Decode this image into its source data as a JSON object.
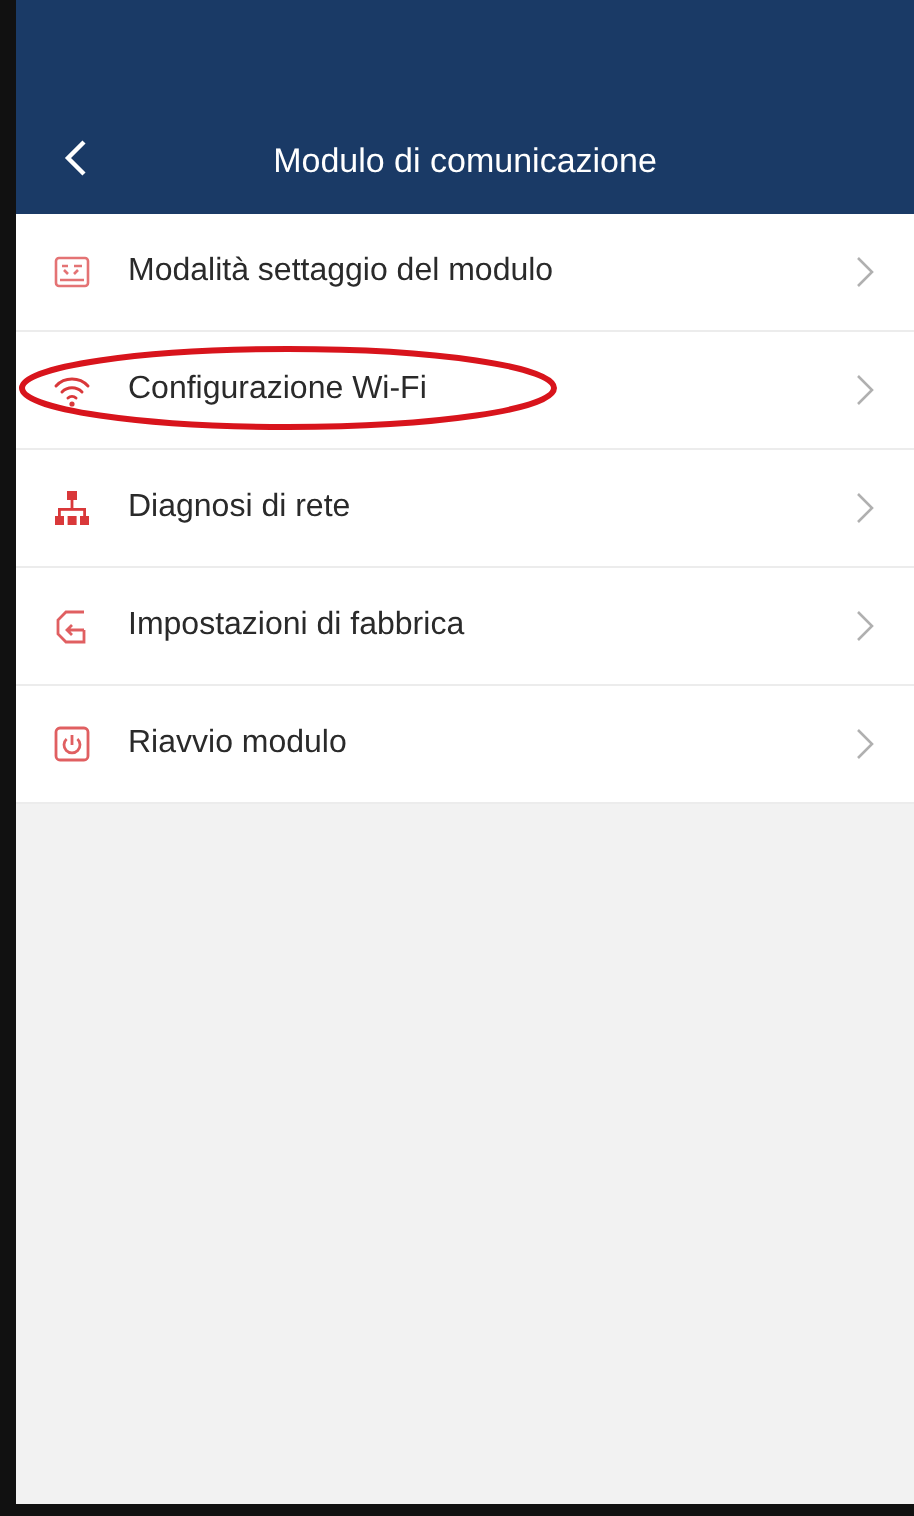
{
  "header": {
    "title": "Modulo di comunicazione"
  },
  "items": [
    {
      "label": "Modalità settaggio del modulo",
      "kind": "module",
      "circled": false
    },
    {
      "label": "Configurazione Wi-Fi",
      "kind": "wifi",
      "circled": true
    },
    {
      "label": "Diagnosi di rete",
      "kind": "network",
      "circled": false
    },
    {
      "label": "Impostazioni di fabbrica",
      "kind": "factory",
      "circled": false
    },
    {
      "label": "Riavvio modulo",
      "kind": "power",
      "circled": false
    }
  ]
}
